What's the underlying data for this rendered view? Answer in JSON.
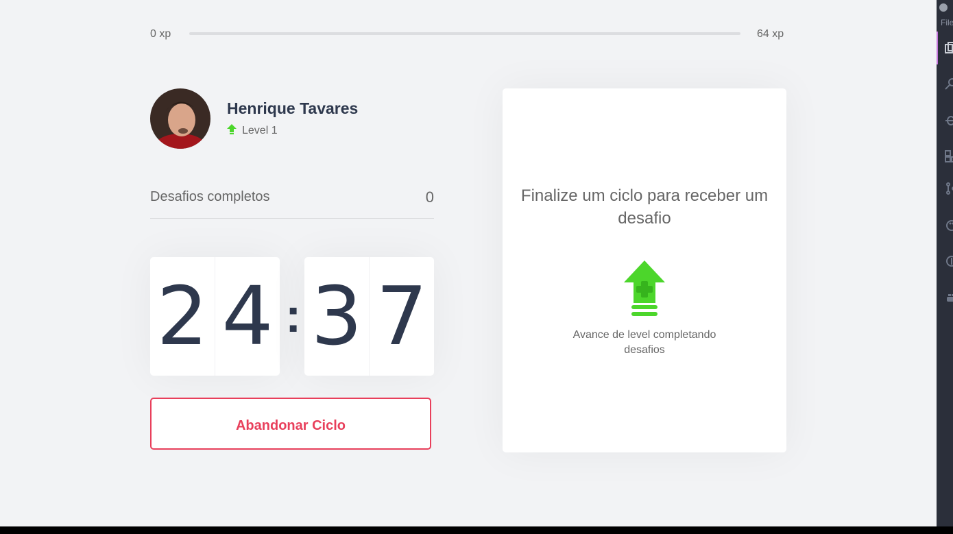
{
  "xp": {
    "min_label": "0 xp",
    "max_label": "64 xp",
    "progress": 0
  },
  "profile": {
    "name": "Henrique Tavares",
    "level_label": "Level 1"
  },
  "completed": {
    "label": "Desafios completos",
    "value": "0"
  },
  "countdown": {
    "minutes": [
      "2",
      "4"
    ],
    "separator": ":",
    "seconds": [
      "3",
      "7"
    ]
  },
  "actions": {
    "abandon_label": "Abandonar Ciclo"
  },
  "challenge": {
    "title": "Finalize um ciclo para receber um desafio",
    "description": "Avance de level completando desafios"
  },
  "editor": {
    "file_label": "File"
  },
  "colors": {
    "accent_green": "#4cd62b",
    "danger": "#e83f5b",
    "text_dark": "#2e384d",
    "text": "#666666",
    "background": "#f2f3f5"
  }
}
